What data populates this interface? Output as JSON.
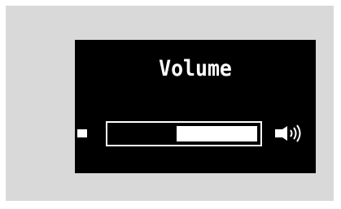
{
  "screen": {
    "title": "Volume"
  },
  "volume_bar": {
    "level_fraction": 0.55
  },
  "icons": {
    "min": "speaker-min-icon",
    "max": "speaker-max-icon"
  },
  "colors": {
    "screen_bg": "#000000",
    "foreground": "#ffffff",
    "frame_bg": "#d9d9d9"
  }
}
